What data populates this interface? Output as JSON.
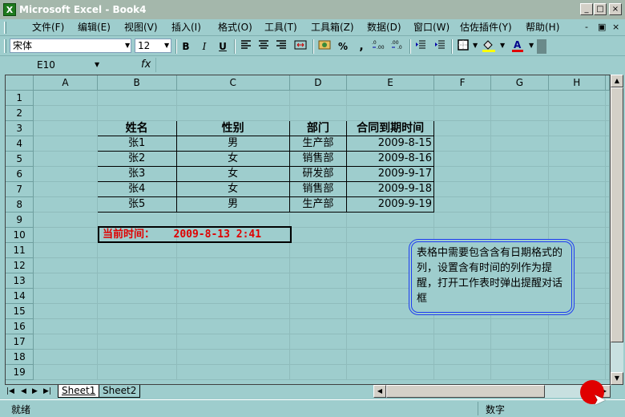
{
  "window": {
    "title": "Microsoft Excel - Book4",
    "app_icon_text": "X"
  },
  "window_controls": {
    "minimize": "_",
    "restore": "□",
    "close": "×"
  },
  "menu": {
    "items": [
      "文件(F)",
      "编辑(E)",
      "视图(V)",
      "插入(I)",
      "格式(O)",
      "工具(T)",
      "工具箱(Z)",
      "数据(D)",
      "窗口(W)",
      "估佐插件(Y)",
      "帮助(H)"
    ],
    "mdi_controls": [
      "-",
      "▣",
      "×"
    ]
  },
  "toolbar": {
    "font_name": "宋体",
    "font_size": "12",
    "bold": "B",
    "italic": "I",
    "underline": "U",
    "percent": "%",
    "comma": ","
  },
  "formula_bar": {
    "name_box": "E10",
    "fx": "fx",
    "content": ""
  },
  "columns": [
    "A",
    "B",
    "C",
    "D",
    "E",
    "F",
    "G",
    "H"
  ],
  "rows": [
    "1",
    "2",
    "3",
    "4",
    "5",
    "6",
    "7",
    "8",
    "9",
    "10",
    "11",
    "12",
    "13",
    "14",
    "15",
    "16",
    "17",
    "18",
    "19"
  ],
  "table": {
    "headers": [
      "姓名",
      "性别",
      "部门",
      "合同到期时间"
    ],
    "rows": [
      [
        "张1",
        "男",
        "生产部",
        "2009-8-15"
      ],
      [
        "张2",
        "女",
        "销售部",
        "2009-8-16"
      ],
      [
        "张3",
        "女",
        "研发部",
        "2009-9-17"
      ],
      [
        "张4",
        "女",
        "销售部",
        "2009-9-18"
      ],
      [
        "张5",
        "男",
        "生产部",
        "2009-9-19"
      ]
    ]
  },
  "current_time": {
    "label": "当前时间：",
    "value": "2009-8-13 2:41"
  },
  "callout": {
    "text": "表格中需要包含含有日期格式的列，设置含有时间的列作为提醒，打开工作表时弹出提醒对话框"
  },
  "sheet_tabs": [
    "Sheet1",
    "Sheet2"
  ],
  "status": {
    "left": "就绪",
    "right": "数字"
  },
  "colors": {
    "background": "#9ecdcd",
    "accent_red": "#e00000",
    "callout_border": "#1e3cf0"
  }
}
